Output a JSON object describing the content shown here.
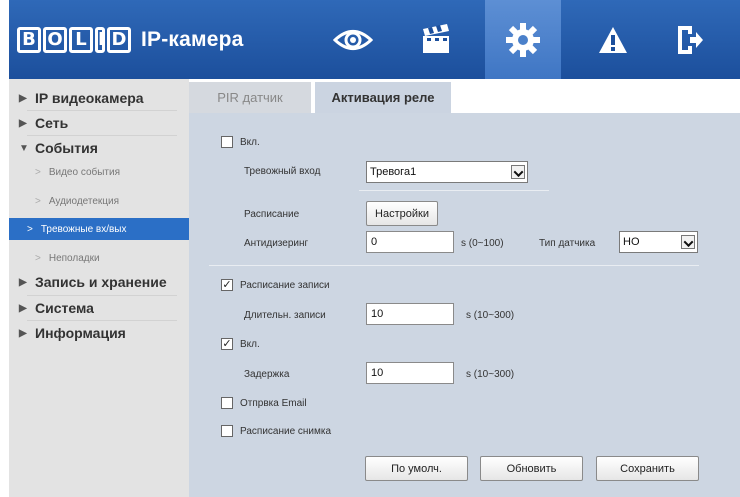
{
  "header": {
    "logo_letters": [
      "B",
      "O",
      "L",
      "I",
      "D"
    ],
    "logo_text": "IP-камера",
    "nav_icons": [
      "eye-icon",
      "clapperboard-icon",
      "gear-icon",
      "warning-icon",
      "exit-icon"
    ],
    "active_nav": "gear-icon"
  },
  "sidebar": {
    "items": [
      {
        "label": "IP видеокамера",
        "arrow": "▶"
      },
      {
        "label": "Сеть",
        "arrow": "▶"
      },
      {
        "label": "События",
        "arrow": "▼"
      },
      {
        "label": "Запись и хранение",
        "arrow": "▶"
      },
      {
        "label": "Система",
        "arrow": "▶"
      },
      {
        "label": "Информация",
        "arrow": "▶"
      }
    ],
    "sub_items": [
      {
        "label": "Видео события"
      },
      {
        "label": "Аудиодетекция"
      },
      {
        "label": "Тревожные вх/вых",
        "active": true
      },
      {
        "label": "Неполадки"
      }
    ],
    "sub_arrow": ">"
  },
  "tabs": [
    {
      "label": "PIR датчик"
    },
    {
      "label": "Активация реле",
      "active": true
    }
  ],
  "form": {
    "enable_label": "Вкл.",
    "enable_checked": "",
    "alarm_input_label": "Тревожный вход",
    "alarm_input_value": "Тревога1",
    "schedule_label": "Расписание",
    "settings_button": "Настройки",
    "antidither_label": "Антидизеринг",
    "antidither_value": "0",
    "antidither_range": "s (0~100)",
    "sensor_type_label": "Тип датчика",
    "sensor_type_value": "НО",
    "record_schedule_label": "Расписание записи",
    "record_schedule_checked": "✓",
    "record_duration_label": "Длительн. записи",
    "record_duration_value": "10",
    "record_duration_range": "s (10~300)",
    "relay_enable_label": "Вкл.",
    "relay_enable_checked": "✓",
    "delay_label": "Задержка",
    "delay_value": "10",
    "delay_range": "s (10~300)",
    "email_label": "Отпрвка Email",
    "email_checked": "",
    "snapshot_label": "Расписание снимка",
    "snapshot_checked": ""
  },
  "buttons": {
    "default": "По умолч.",
    "refresh": "Обновить",
    "save": "Сохранить"
  },
  "colors": {
    "header": "#1c4f9c",
    "active_nav": "#3f76c4",
    "sidebar_active": "#2b6fc6",
    "panel": "#cdd6e2"
  }
}
